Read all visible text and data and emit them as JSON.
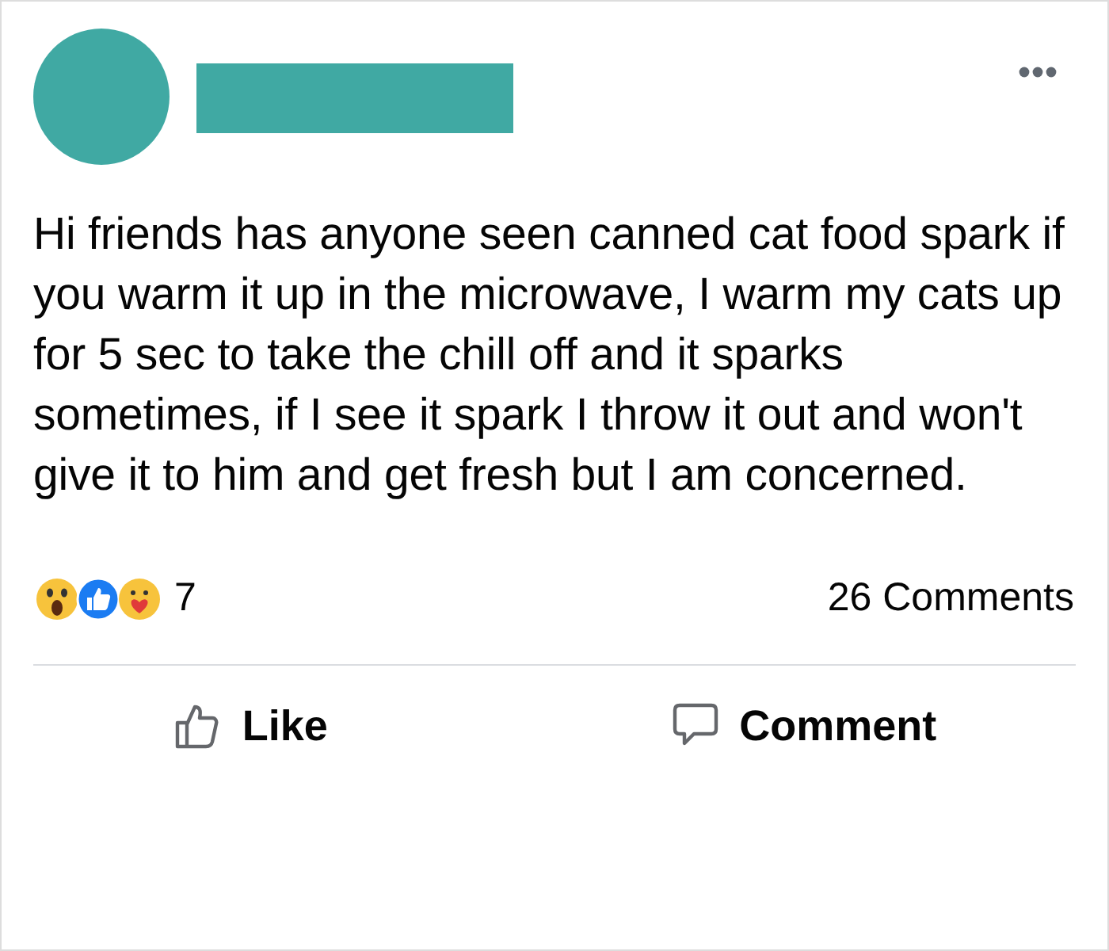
{
  "post": {
    "text": "Hi friends has anyone seen canned cat food spark if you warm it up in the microwave, I warm my cats up for 5 sec to take the chill off and it sparks sometimes, if I see it spark I throw it out and won't give it to him and get fresh but I am concerned."
  },
  "reactions": {
    "count": "7",
    "comments": "26 Comments"
  },
  "actions": [
    {
      "kind": "like",
      "label": "Like"
    },
    {
      "kind": "comment",
      "label": "Comment"
    }
  ]
}
